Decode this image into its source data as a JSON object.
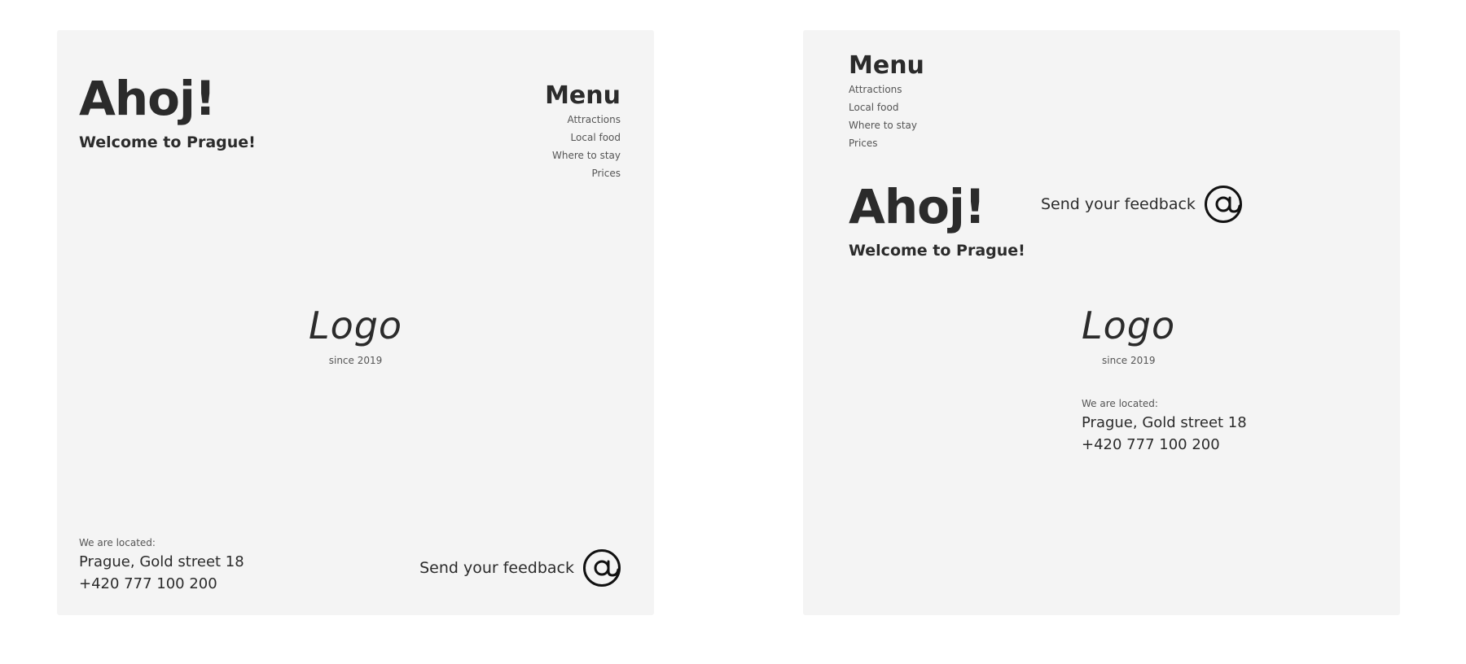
{
  "left_card": {
    "greeting": "Ahoj!",
    "welcome": "Welcome to Prague!",
    "menu": {
      "title": "Menu",
      "items": [
        {
          "label": "Attractions"
        },
        {
          "label": "Local food"
        },
        {
          "label": "Where to stay"
        },
        {
          "label": "Prices"
        }
      ]
    },
    "logo": {
      "text": "Logo",
      "since": "since 2019"
    },
    "location": {
      "label": "We are located:",
      "address": "Prague, Gold street 18",
      "phone": "+420 777 100 200"
    },
    "feedback": {
      "label": "Send your feedback",
      "icon": "at-sign-icon"
    }
  },
  "right_card": {
    "menu": {
      "title": "Menu",
      "items": [
        {
          "label": "Attractions"
        },
        {
          "label": "Local food"
        },
        {
          "label": "Where to stay"
        },
        {
          "label": "Prices"
        }
      ]
    },
    "greeting": "Ahoj!",
    "welcome": "Welcome to Prague!",
    "feedback": {
      "label": "Send your feedback",
      "icon": "at-sign-icon"
    },
    "logo": {
      "text": "Logo",
      "since": "since 2019"
    },
    "location": {
      "label": "We are located:",
      "address": "Prague, Gold street 18",
      "phone": "+420 777 100 200"
    }
  },
  "colors": {
    "background": "#ffffff",
    "card": "#f4f4f4",
    "text_dark": "#2b2b2b",
    "text_muted": "#555555",
    "icon": "#111111"
  }
}
